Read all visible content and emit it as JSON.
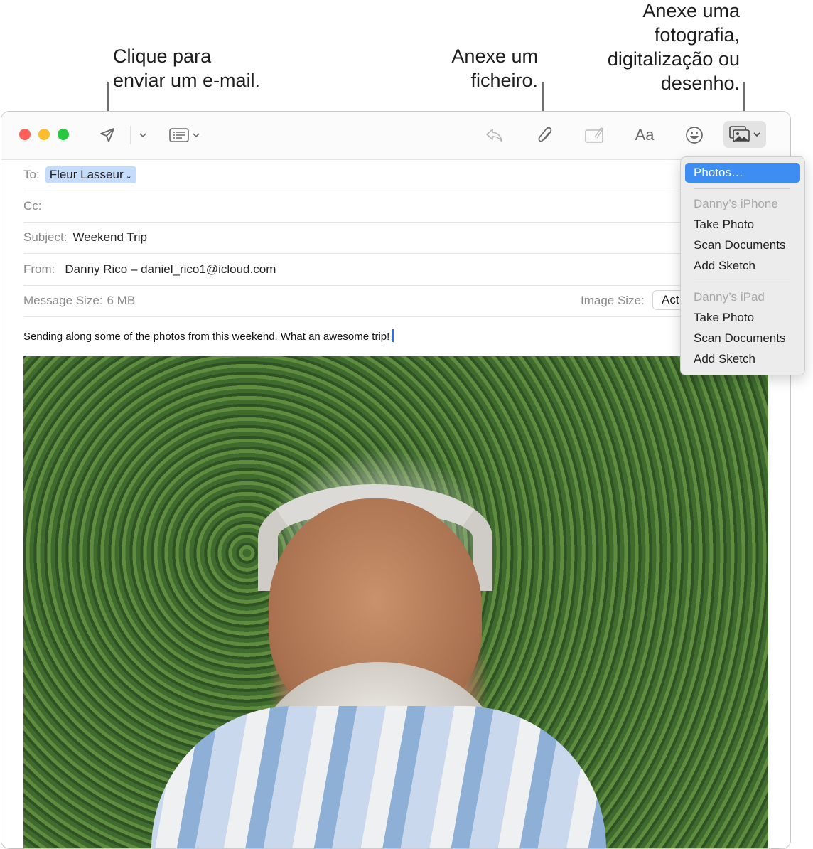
{
  "callouts": {
    "send": [
      "Clique para",
      "enviar um e-mail."
    ],
    "attach": [
      "Anexe um",
      "ficheiro."
    ],
    "photo": [
      "Anexe uma",
      "fotografia,",
      "digitalização ou",
      "desenho."
    ]
  },
  "toolbar": {
    "icons": [
      "send-icon",
      "send-options-chevron",
      "header-fields-icon",
      "reply-icon",
      "attachment-icon",
      "markup-icon",
      "format-icon",
      "emoji-icon",
      "photo-browser-icon"
    ],
    "format_label": "Aa",
    "traffic_lights": {
      "close": "#fe5f57",
      "minimize": "#febc2e",
      "zoom": "#28c840"
    }
  },
  "header": {
    "to_label": "To:",
    "to_recipient": "Fleur Lasseur",
    "cc_label": "Cc:",
    "subject_label": "Subject:",
    "subject_value": "Weekend Trip",
    "from_label": "From:",
    "from_value": "Danny Rico – daniel_rico1@icloud.com",
    "message_size_label": "Message Size:",
    "message_size_value": "6 MB",
    "image_size_label": "Image Size:",
    "image_size_value": "Act"
  },
  "body": {
    "text": "Sending along some of the photos from this weekend. What an awesome trip!"
  },
  "photo_menu": {
    "photos": "Photos…",
    "iphone_header": "Danny’s iPhone",
    "iphone_items": [
      "Take Photo",
      "Scan Documents",
      "Add Sketch"
    ],
    "ipad_header": "Danny’s iPad",
    "ipad_items": [
      "Take Photo",
      "Scan Documents",
      "Add Sketch"
    ],
    "accent": "#3d8df3"
  }
}
